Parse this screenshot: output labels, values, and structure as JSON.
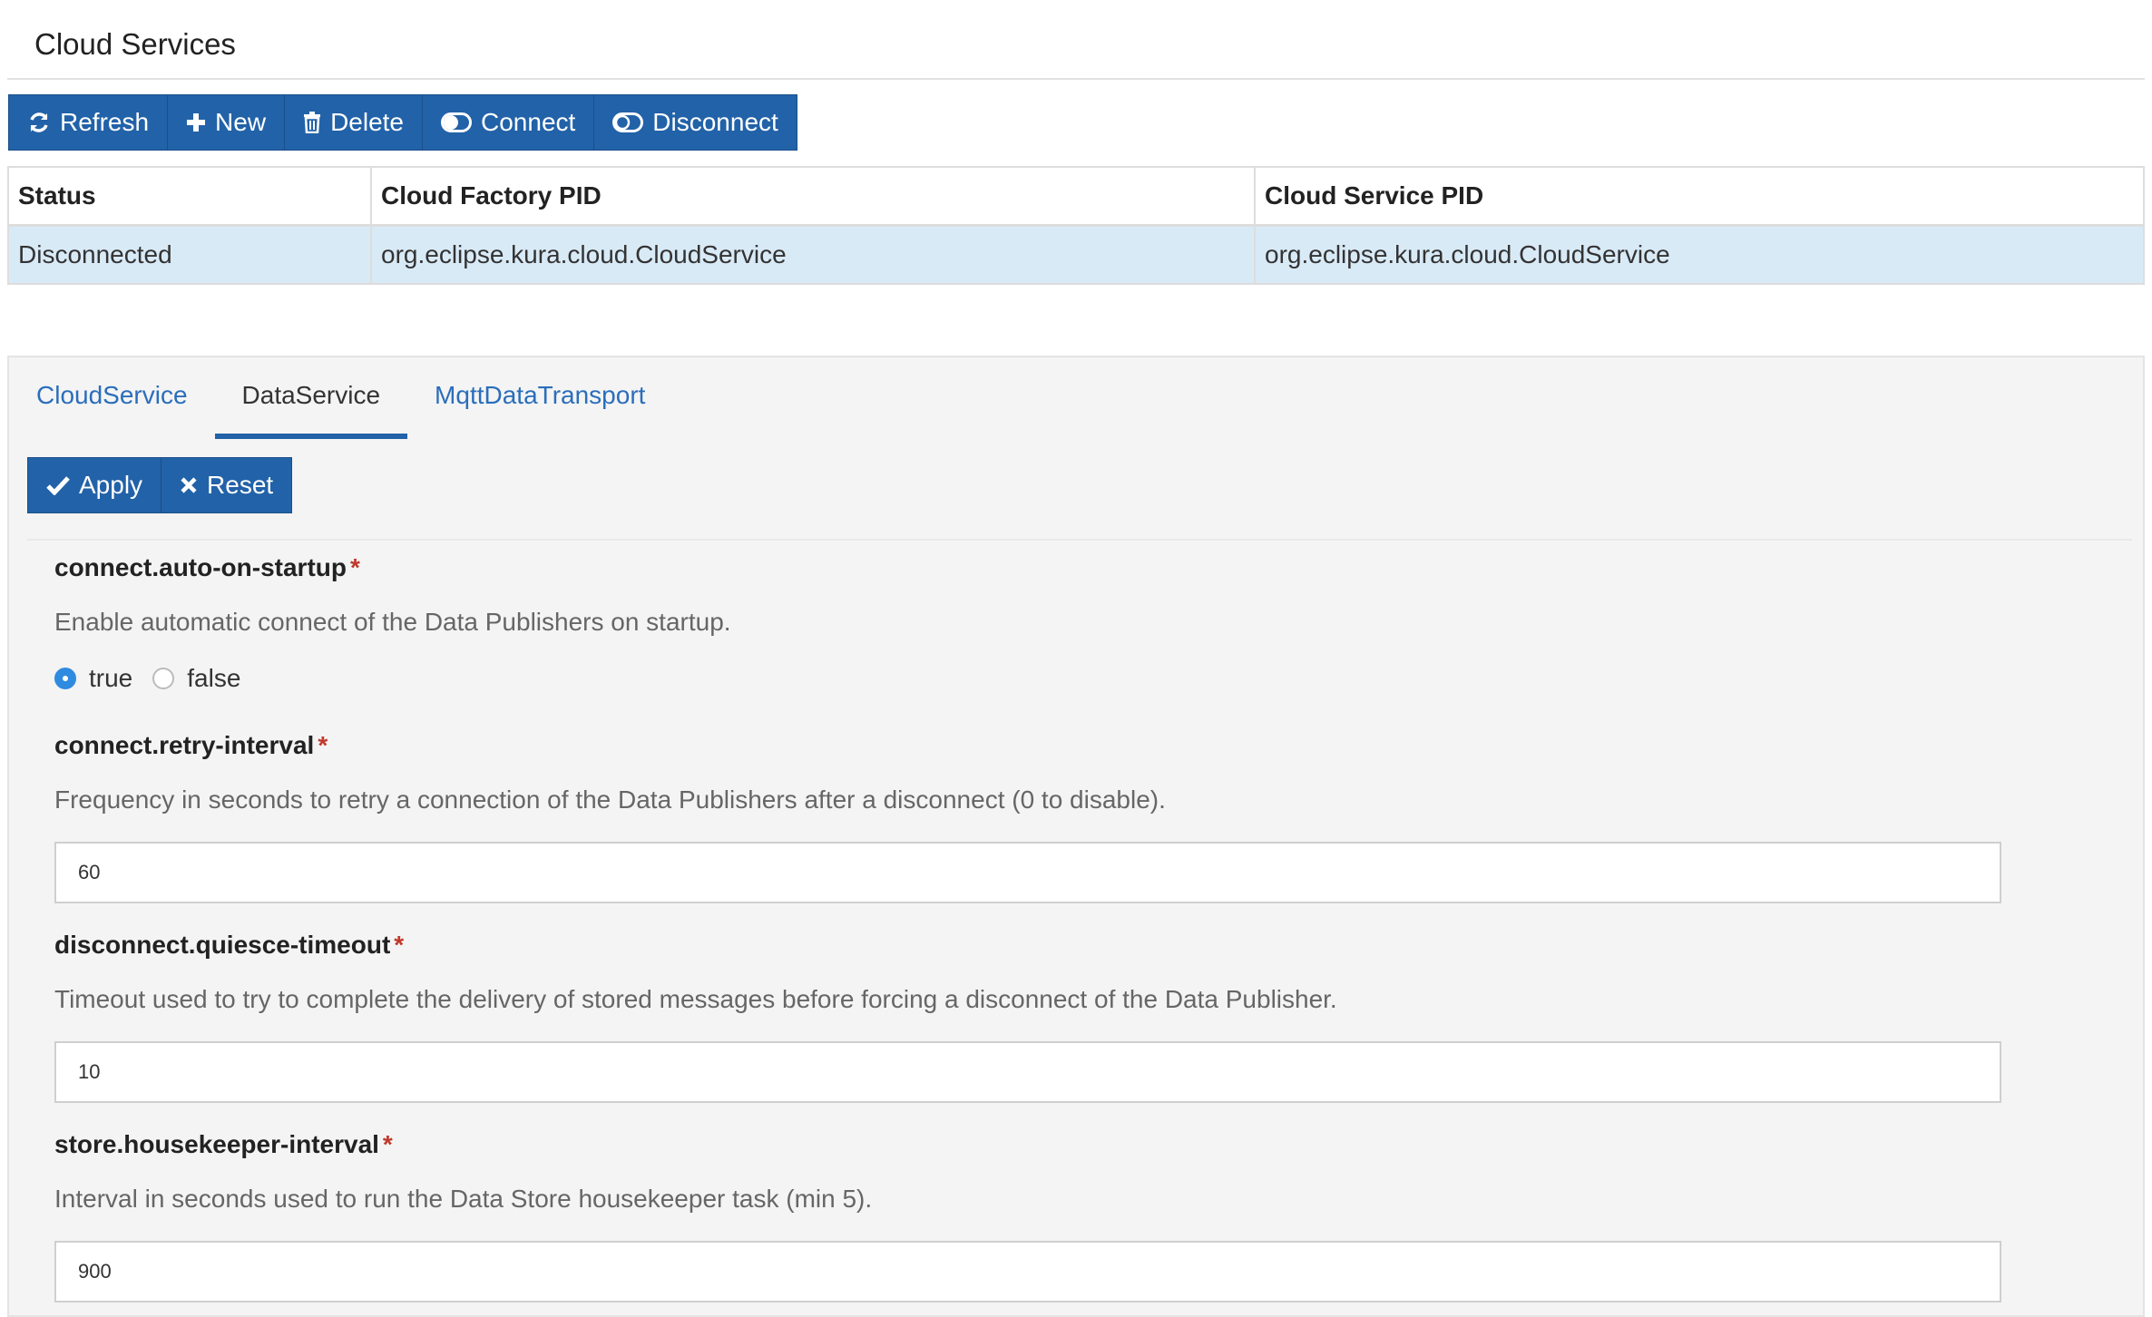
{
  "header": {
    "title": "Cloud Services"
  },
  "toolbar": {
    "buttons": [
      {
        "label": "Refresh",
        "icon": "refresh-icon"
      },
      {
        "label": "New",
        "icon": "plus-icon"
      },
      {
        "label": "Delete",
        "icon": "trash-icon"
      },
      {
        "label": "Connect",
        "icon": "toggle-on-icon"
      },
      {
        "label": "Disconnect",
        "icon": "toggle-off-icon"
      }
    ]
  },
  "table": {
    "columns": [
      "Status",
      "Cloud Factory PID",
      "Cloud Service PID"
    ],
    "rows": [
      [
        "Disconnected",
        "org.eclipse.kura.cloud.CloudService",
        "org.eclipse.kura.cloud.CloudService"
      ]
    ]
  },
  "tabs": [
    {
      "label": "CloudService",
      "active": false
    },
    {
      "label": "DataService",
      "active": true
    },
    {
      "label": "MqttDataTransport",
      "active": false
    }
  ],
  "actions": {
    "apply_label": "Apply",
    "reset_label": "Reset"
  },
  "properties": {
    "auto_startup": {
      "name": "connect.auto-on-startup",
      "description": "Enable automatic connect of the Data Publishers on startup.",
      "options": [
        "true",
        "false"
      ],
      "selected": "true"
    },
    "retry_interval": {
      "name": "connect.retry-interval",
      "description": "Frequency in seconds to retry a connection of the Data Publishers after a disconnect (0 to disable).",
      "value": "60"
    },
    "quiesce_timeout": {
      "name": "disconnect.quiesce-timeout",
      "description": "Timeout used to try to complete the delivery of stored messages before forcing a disconnect of the Data Publisher.",
      "value": "10"
    },
    "housekeeper_interval": {
      "name": "store.housekeeper-interval",
      "description": "Interval in seconds used to run the Data Store housekeeper task (min 5).",
      "value": "900"
    }
  },
  "required_marker": "*",
  "colors": {
    "primary": "#2262a8",
    "link": "#2a6ebb",
    "selected_row": "#d9eaf7",
    "required": "#c0392b"
  }
}
